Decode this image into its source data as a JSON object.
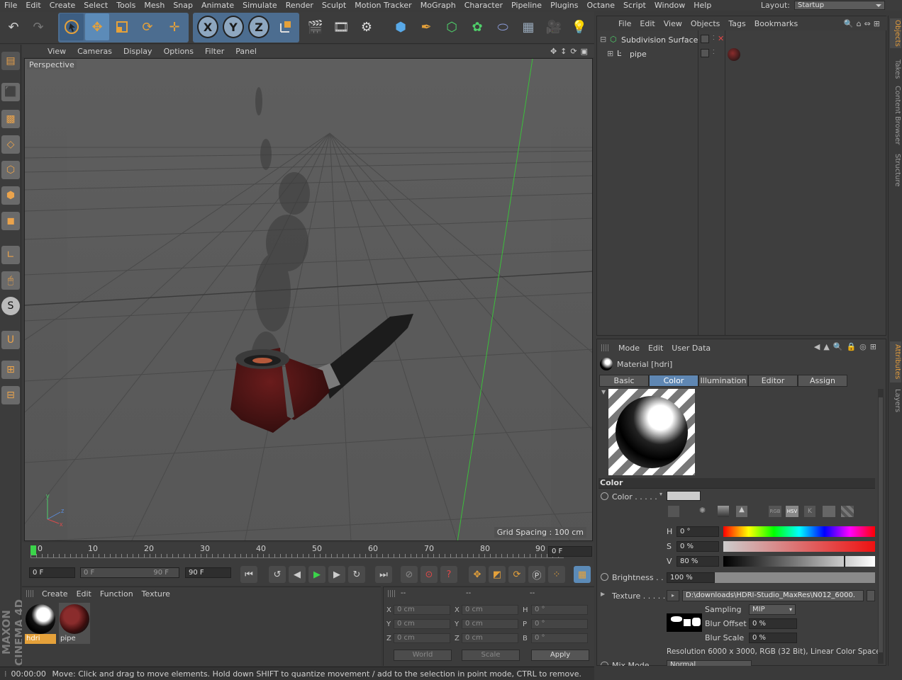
{
  "menubar": {
    "items": [
      "File",
      "Edit",
      "Create",
      "Select",
      "Tools",
      "Mesh",
      "Snap",
      "Animate",
      "Simulate",
      "Render",
      "Sculpt",
      "Motion Tracker",
      "MoGraph",
      "Character",
      "Pipeline",
      "Plugins",
      "Octane",
      "Script",
      "Window",
      "Help"
    ],
    "layout_label": "Layout:",
    "layout_value": "Startup"
  },
  "toolbar": {
    "axis_x": "X",
    "axis_y": "Y",
    "axis_z": "Z"
  },
  "viewport": {
    "menu": [
      "View",
      "Cameras",
      "Display",
      "Options",
      "Filter",
      "Panel"
    ],
    "camera_label": "Perspective",
    "grid_spacing": "Grid Spacing : 100 cm"
  },
  "timeline": {
    "ticks": [
      "0",
      "10",
      "20",
      "30",
      "40",
      "50",
      "60",
      "70",
      "80",
      "90"
    ],
    "current_frame": "0 F",
    "start_field": "0 F",
    "range_start": "0 F",
    "range_end": "90 F",
    "end_field": "90 F"
  },
  "materials": {
    "menu": [
      "Create",
      "Edit",
      "Function",
      "Texture"
    ],
    "items": [
      {
        "name": "hdri",
        "selected": true
      },
      {
        "name": "pipe",
        "selected": false
      }
    ]
  },
  "coordinates": {
    "header": [
      "--",
      "--",
      "--"
    ],
    "rows": [
      {
        "pos_label": "X",
        "pos": "0 cm",
        "size_label": "X",
        "size": "0 cm",
        "rot_label": "H",
        "rot": "0 °"
      },
      {
        "pos_label": "Y",
        "pos": "0 cm",
        "size_label": "Y",
        "size": "0 cm",
        "rot_label": "P",
        "rot": "0 °"
      },
      {
        "pos_label": "Z",
        "pos": "0 cm",
        "size_label": "Z",
        "size": "0 cm",
        "rot_label": "B",
        "rot": "0 °"
      }
    ],
    "world": "World",
    "scale": "Scale",
    "apply": "Apply"
  },
  "status": {
    "time": "00:00:00",
    "message": "Move: Click and drag to move elements. Hold down SHIFT to quantize movement / add to the selection in point mode, CTRL to remove."
  },
  "objects": {
    "menu": [
      "File",
      "Edit",
      "View",
      "Objects",
      "Tags",
      "Bookmarks"
    ],
    "items": [
      {
        "name": "Subdivision Surface"
      },
      {
        "name": "pipe"
      }
    ]
  },
  "attributes": {
    "menu": [
      "Mode",
      "Edit",
      "User Data"
    ],
    "title": "Material [hdri]",
    "tabs": [
      "Basic",
      "Color",
      "Illumination",
      "Editor",
      "Assign"
    ],
    "active_tab": "Color",
    "section": "Color",
    "color_label": "Color . . . . .",
    "h_label": "H",
    "h_value": "0 °",
    "s_label": "S",
    "s_value": "0 %",
    "v_label": "V",
    "v_value": "80 %",
    "v_level": 0.8,
    "brightness_label": "Brightness . . .",
    "brightness_value": "100 %",
    "texture_label": "Texture . . . . . .",
    "texture_path": "D:\\downloads\\HDRI-Studio_MaxRes\\N012_6000.",
    "sampling_label": "Sampling",
    "sampling_value": "MIP",
    "blur_offset_label": "Blur Offset",
    "blur_offset_value": "0 %",
    "blur_scale_label": "Blur Scale",
    "blur_scale_value": "0 %",
    "resolution": "Resolution 6000 x 3000, RGB (32 Bit), Linear Color Space",
    "mix_mode_label": "Mix Mode",
    "mix_mode_value": "Normal",
    "color_mode_icons": [
      "RGB",
      "HSV",
      "K"
    ]
  },
  "side_tabs": [
    "Objects",
    "Takes",
    "Content Browser",
    "Structure"
  ],
  "side_tabs_lower": [
    "Attributes",
    "Layers"
  ],
  "branding": "MAXON CINEMA 4D",
  "colors": {
    "accent_orange": "#e5a13a",
    "selection_blue": "#5f87b3",
    "play_green": "#3bd44a"
  }
}
